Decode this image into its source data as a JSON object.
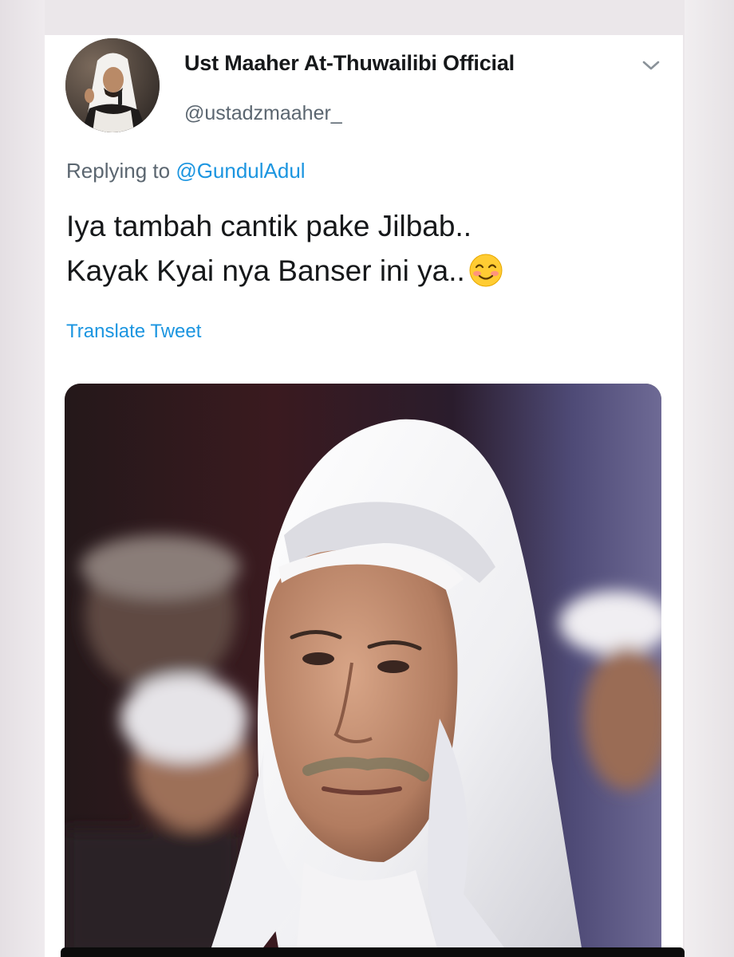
{
  "tweet": {
    "display_name": "Ust Maaher At-Thuwailibi Official",
    "handle": "@ustadzmaaher_",
    "replying_prefix": "Replying to",
    "reply_to_handle": "@GundulAdul",
    "text_line1": "Iya tambah cantik pake Jilbab..",
    "text_line2": "Kayak Kyai nya Banser ini ya..",
    "emoji": "smiling-face-with-blush",
    "translate_label": "Translate Tweet",
    "media_description": "photo-of-man-in-white-headscarf"
  },
  "colors": {
    "link": "#1b95e0",
    "text_primary": "#16181a",
    "text_secondary": "#5b6670",
    "card_bg": "#ffffff",
    "frame_bg": "#ebe7ea"
  }
}
